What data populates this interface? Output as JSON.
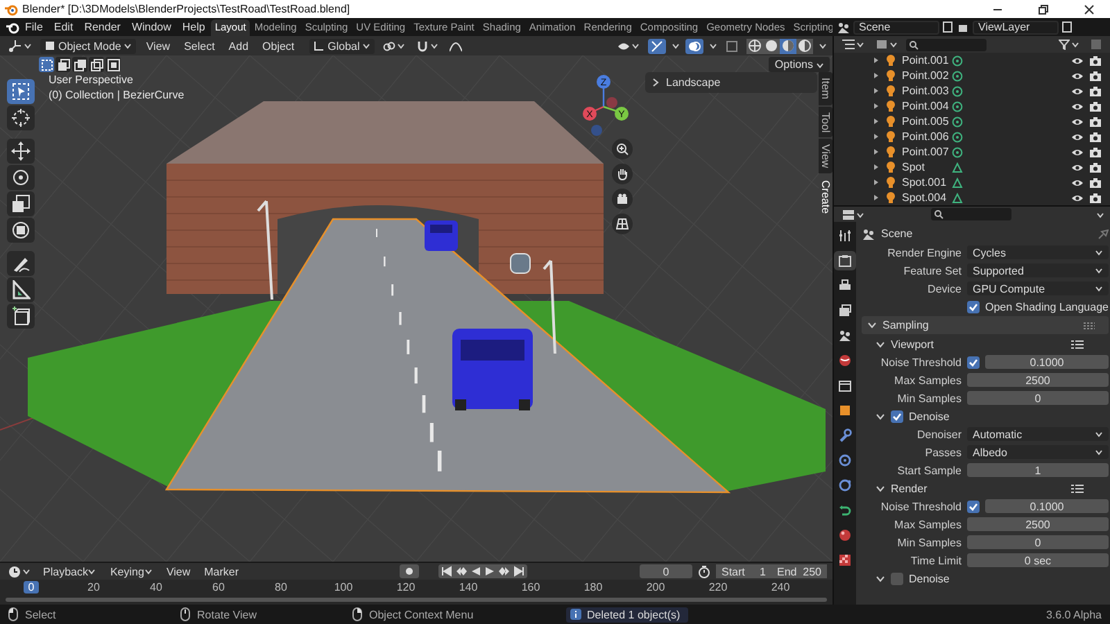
{
  "window": {
    "title": "Blender* [D:\\3DModels\\BlenderProjects\\TestRoad\\TestRoad.blend]"
  },
  "menu": [
    "File",
    "Edit",
    "Render",
    "Window",
    "Help"
  ],
  "workspaces": [
    {
      "label": "Layout",
      "selected": true
    },
    {
      "label": "Modeling",
      "selected": false
    },
    {
      "label": "Sculpting",
      "selected": false
    },
    {
      "label": "UV Editing",
      "selected": false
    },
    {
      "label": "Texture Paint",
      "selected": false
    },
    {
      "label": "Shading",
      "selected": false
    },
    {
      "label": "Animation",
      "selected": false
    },
    {
      "label": "Rendering",
      "selected": false
    },
    {
      "label": "Compositing",
      "selected": false
    },
    {
      "label": "Geometry Nodes",
      "selected": false
    },
    {
      "label": "Scripting",
      "selected": false
    }
  ],
  "scene_selector": {
    "scene": "Scene",
    "view_layer": "ViewLayer"
  },
  "viewport_header": {
    "mode": "Object Mode",
    "menus": [
      "View",
      "Select",
      "Add",
      "Object"
    ],
    "orientation": "Global",
    "shading": [
      {
        "kind": "wireframe",
        "selected": false
      },
      {
        "kind": "solid",
        "selected": false
      },
      {
        "kind": "material",
        "selected": true
      },
      {
        "kind": "rendered",
        "selected": false
      }
    ]
  },
  "viewport": {
    "select_modes": [
      {
        "kind": "new",
        "selected": true
      },
      {
        "kind": "extend",
        "selected": false
      },
      {
        "kind": "subtract",
        "selected": false
      },
      {
        "kind": "invert",
        "selected": false
      },
      {
        "kind": "intersect",
        "selected": false
      }
    ],
    "options": "Options",
    "tools": [
      {
        "kind": "select",
        "selected": true
      },
      {
        "kind": "cursor",
        "selected": false
      },
      {
        "kind": "move",
        "selected": false
      },
      {
        "kind": "rotate",
        "selected": false
      },
      {
        "kind": "scale",
        "selected": false
      },
      {
        "kind": "transform",
        "selected": false
      },
      {
        "kind": "annotate",
        "selected": false
      },
      {
        "kind": "measure",
        "selected": false
      },
      {
        "kind": "add_cube",
        "selected": false
      }
    ],
    "view_name": "User Perspective",
    "collection": "(0) Collection | BezierCurve",
    "gizmo": {
      "x": "X",
      "y": "Y",
      "z": "Z"
    },
    "panel": {
      "title": "Landscape",
      "expanded": false
    },
    "side_tabs": [
      {
        "label": "Item",
        "selected": false
      },
      {
        "label": "Tool",
        "selected": false
      },
      {
        "label": "View",
        "selected": false
      },
      {
        "label": "Create",
        "selected": true
      }
    ]
  },
  "outliner": {
    "items": [
      {
        "name": "Point.001",
        "kind": "point"
      },
      {
        "name": "Point.002",
        "kind": "point"
      },
      {
        "name": "Point.003",
        "kind": "point"
      },
      {
        "name": "Point.004",
        "kind": "point"
      },
      {
        "name": "Point.005",
        "kind": "point"
      },
      {
        "name": "Point.006",
        "kind": "point"
      },
      {
        "name": "Point.007",
        "kind": "point"
      },
      {
        "name": "Spot",
        "kind": "spot"
      },
      {
        "name": "Spot.001",
        "kind": "spot"
      },
      {
        "name": "Spot.004",
        "kind": "spot"
      }
    ]
  },
  "properties": {
    "tabs": [
      {
        "kind": "tool",
        "selected": false
      },
      {
        "kind": "render",
        "selected": true
      },
      {
        "kind": "output",
        "selected": false
      },
      {
        "kind": "view_layer",
        "selected": false
      },
      {
        "kind": "scene",
        "selected": false
      },
      {
        "kind": "world",
        "selected": false
      },
      {
        "kind": "collection",
        "selected": false
      },
      {
        "kind": "object",
        "selected": false
      },
      {
        "kind": "modifier",
        "selected": false
      },
      {
        "kind": "particles",
        "selected": false
      },
      {
        "kind": "physics",
        "selected": false
      },
      {
        "kind": "constraints",
        "selected": false
      },
      {
        "kind": "material",
        "selected": false
      },
      {
        "kind": "texture",
        "selected": false
      }
    ],
    "title": "Scene",
    "rows": [
      {
        "kind": "dropdown",
        "label": "Render Engine",
        "value": "Cycles"
      },
      {
        "kind": "dropdown",
        "label": "Feature Set",
        "value": "Supported"
      },
      {
        "kind": "dropdown",
        "label": "Device",
        "value": "GPU Compute"
      },
      {
        "kind": "checkbox",
        "label": "Open Shading Language",
        "checked": true
      },
      {
        "kind": "section",
        "label": "Sampling",
        "expanded": true
      },
      {
        "kind": "subsection",
        "label": "Viewport",
        "expanded": true
      },
      {
        "kind": "check_number",
        "label": "Noise Threshold",
        "checked": true,
        "value": "0.1000"
      },
      {
        "kind": "number",
        "label": "Max Samples",
        "value": "2500"
      },
      {
        "kind": "number",
        "label": "Min Samples",
        "value": "0"
      },
      {
        "kind": "check_subsection",
        "label": "Denoise",
        "checked": true,
        "expanded": true
      },
      {
        "kind": "dropdown",
        "label": "Denoiser",
        "value": "Automatic"
      },
      {
        "kind": "dropdown",
        "label": "Passes",
        "value": "Albedo"
      },
      {
        "kind": "number",
        "label": "Start Sample",
        "value": "1"
      },
      {
        "kind": "subsection",
        "label": "Render",
        "expanded": true
      },
      {
        "kind": "check_number",
        "label": "Noise Threshold",
        "checked": true,
        "value": "0.1000"
      },
      {
        "kind": "number",
        "label": "Max Samples",
        "value": "2500"
      },
      {
        "kind": "number",
        "label": "Min Samples",
        "value": "0"
      },
      {
        "kind": "number",
        "label": "Time Limit",
        "value": "0 sec"
      },
      {
        "kind": "check_subsection",
        "label": "Denoise",
        "checked": false,
        "expanded": true
      }
    ]
  },
  "timeline": {
    "menus": [
      "Playback",
      "Keying",
      "View",
      "Marker"
    ],
    "current_frame": "0",
    "start_label": "Start",
    "start": "1",
    "end_label": "End",
    "end": "250",
    "ruler": [
      {
        "label": "0",
        "selected": true
      },
      {
        "label": "20",
        "selected": false
      },
      {
        "label": "40",
        "selected": false
      },
      {
        "label": "60",
        "selected": false
      },
      {
        "label": "80",
        "selected": false
      },
      {
        "label": "100",
        "selected": false
      },
      {
        "label": "120",
        "selected": false
      },
      {
        "label": "140",
        "selected": false
      },
      {
        "label": "160",
        "selected": false
      },
      {
        "label": "180",
        "selected": false
      },
      {
        "label": "200",
        "selected": false
      },
      {
        "label": "220",
        "selected": false
      },
      {
        "label": "240",
        "selected": false
      }
    ]
  },
  "status_bar": {
    "hints": [
      {
        "kind": "mouse_left",
        "label": "Select"
      },
      {
        "kind": "mouse_middle",
        "label": "Rotate View"
      },
      {
        "kind": "mouse_right",
        "label": "Object Context Menu"
      }
    ],
    "message": "Deleted 1 object(s)",
    "version": "3.6.0 Alpha"
  }
}
